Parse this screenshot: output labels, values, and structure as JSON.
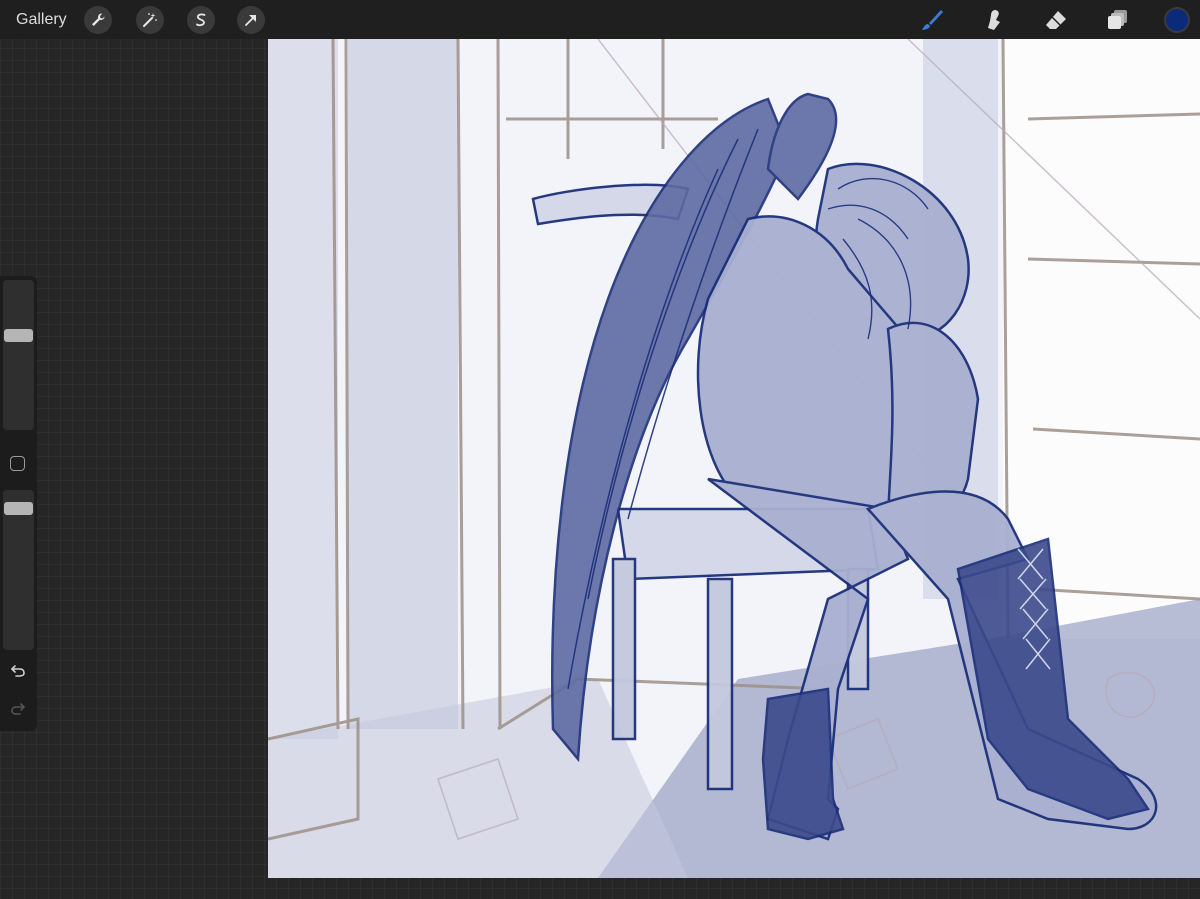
{
  "topbar": {
    "gallery_label": "Gallery",
    "tools_left": [
      "wrench-icon",
      "magic-wand-icon",
      "selection-icon",
      "transform-arrow-icon"
    ],
    "tools_right": [
      "brush-icon",
      "smudge-icon",
      "eraser-icon",
      "layers-icon"
    ],
    "current_color": "#0b2a7a"
  },
  "sidebar": {
    "brush_size_level": 0.36,
    "brush_opacity_level": 0.08
  },
  "colors": {
    "accent_brush": "#3d7bd8",
    "ink": "#1b2f7a",
    "sketch": "#9c8f86",
    "shade": "#8e97bc"
  }
}
